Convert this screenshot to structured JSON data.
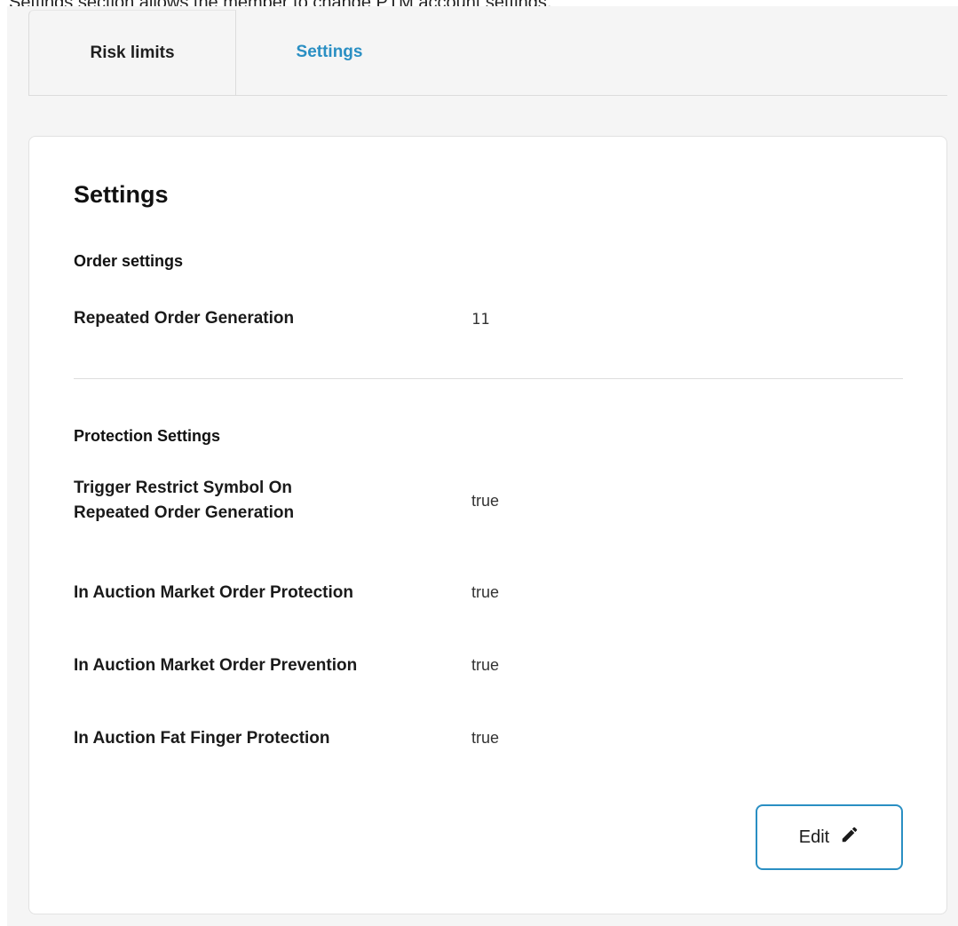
{
  "caption": "Settings section allows the member to change PTM account settings.",
  "tabs": [
    {
      "label": "Risk limits",
      "active": false
    },
    {
      "label": "Settings",
      "active": true
    }
  ],
  "card": {
    "title": "Settings",
    "order_settings": {
      "heading": "Order settings",
      "rows": [
        {
          "label": "Repeated Order Generation",
          "value": "11"
        }
      ]
    },
    "protection_settings": {
      "heading": "Protection Settings",
      "rows": [
        {
          "label": "Trigger Restrict Symbol On Repeated Order Generation",
          "value": "true"
        },
        {
          "label": "In Auction Market Order Protection",
          "value": "true"
        },
        {
          "label": "In Auction Market Order Prevention",
          "value": "true"
        },
        {
          "label": "In Auction Fat Finger Protection",
          "value": "true"
        }
      ]
    },
    "edit_button": {
      "label": "Edit",
      "icon": "pencil-icon"
    }
  },
  "colors": {
    "accent": "#2a8fc3",
    "background": "#f5f5f5",
    "card": "#ffffff"
  }
}
